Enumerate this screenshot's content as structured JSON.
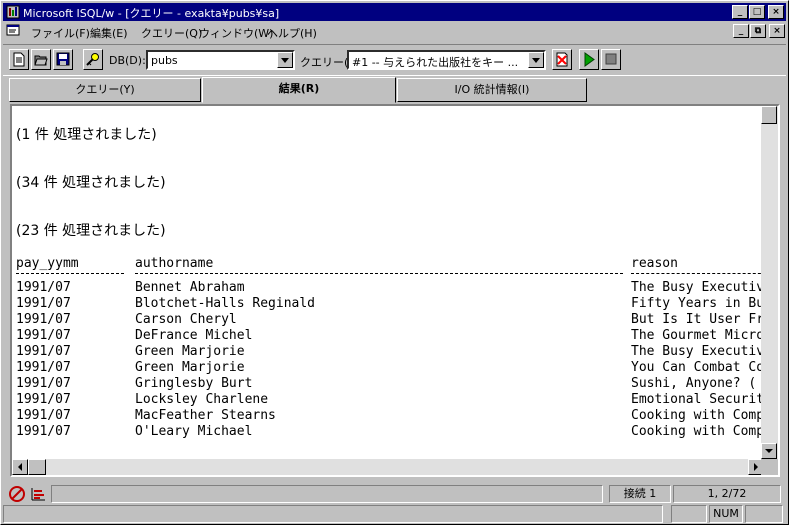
{
  "window": {
    "title": "Microsoft ISQL/w - [クエリー - exakta¥pubs¥sa]",
    "title_buttons": [
      "_",
      "□",
      "×"
    ],
    "mdi_buttons": [
      "_",
      "⧉",
      "×"
    ]
  },
  "menu": {
    "items": [
      "ファイル(F)",
      "編集(E)",
      "クエリー(Q)",
      "ウィンドウ(W)",
      "ヘルプ(H)"
    ]
  },
  "toolbar": {
    "db_label": "DB(D):",
    "db_value": "pubs",
    "query_label": "クエリー(U):",
    "query_value": "#1 -- 与えられた出版社をキー ..."
  },
  "tabs": [
    {
      "label": "クエリー(Y)"
    },
    {
      "label": "結果(R)"
    },
    {
      "label": "I/O 統計情報(I)"
    }
  ],
  "results": {
    "messages": [
      "(1 件 処理されました)",
      "(34 件 処理されました)",
      "(23 件 処理されました)"
    ],
    "columns": [
      "pay_yymm",
      "authorname",
      "reason"
    ],
    "rows": [
      [
        "1991/07",
        "Bennet Abraham",
        "The Busy Executiv"
      ],
      [
        "1991/07",
        "Blotchet-Halls Reginald",
        "Fifty Years in Bu"
      ],
      [
        "1991/07",
        "Carson Cheryl",
        "But Is It User Fr"
      ],
      [
        "1991/07",
        "DeFrance Michel",
        "The Gourmet Micro"
      ],
      [
        "1991/07",
        "Green Marjorie",
        "The Busy Executiv"
      ],
      [
        "1991/07",
        "Green Marjorie",
        "You Can Combat Co"
      ],
      [
        "1991/07",
        "Gringlesby Burt",
        "Sushi, Anyone? ("
      ],
      [
        "1991/07",
        "Locksley Charlene",
        "Emotional Securit"
      ],
      [
        "1991/07",
        "MacFeather Stearns",
        "Cooking with Comp"
      ],
      [
        "1991/07",
        "O'Leary Michael",
        "Cooking with Comp"
      ]
    ]
  },
  "status": {
    "connection": "接続 1",
    "position": "1, 2/72",
    "num": "NUM"
  }
}
